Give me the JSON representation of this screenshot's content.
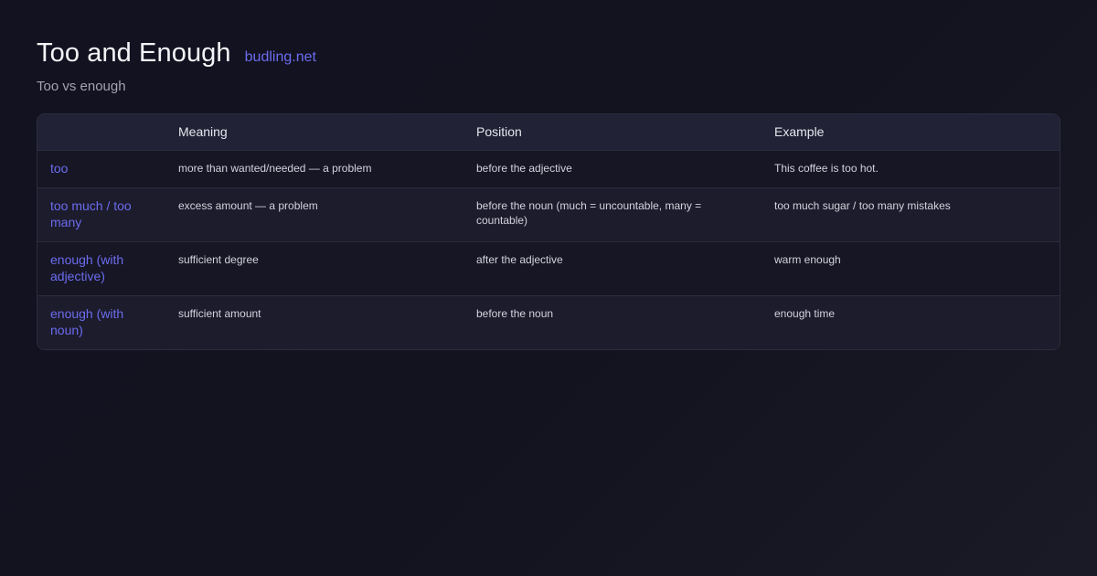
{
  "header": {
    "title": "Too and Enough",
    "site_link": "budling.net",
    "subtitle": "Too vs enough"
  },
  "table": {
    "columns": [
      "",
      "Meaning",
      "Position",
      "Example"
    ],
    "rows": [
      {
        "term": "too",
        "meaning": "more than wanted/needed — a problem",
        "position": "before the adjective",
        "example": "This coffee is too hot."
      },
      {
        "term": "too much / too many",
        "meaning": "excess amount — a problem",
        "position": "before the noun (much = uncountable, many = countable)",
        "example": "too much sugar / too many mistakes"
      },
      {
        "term": "enough (with adjective)",
        "meaning": "sufficient degree",
        "position": "after the adjective",
        "example": "warm enough"
      },
      {
        "term": "enough (with noun)",
        "meaning": "sufficient amount",
        "position": "before the noun",
        "example": "enough time"
      }
    ]
  },
  "colors": {
    "background": "#13131f",
    "accent": "#6c6cf0",
    "header_row": "#222236",
    "border": "#2c2c3e"
  }
}
